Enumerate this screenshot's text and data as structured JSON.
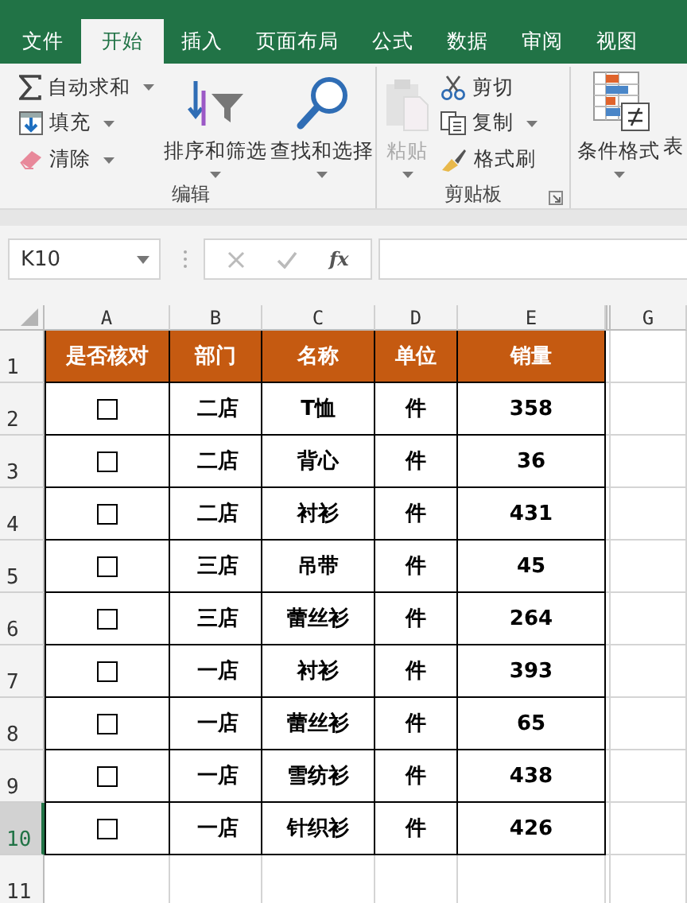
{
  "tabs": [
    {
      "label": "文件",
      "selected": false
    },
    {
      "label": "开始",
      "selected": true
    },
    {
      "label": "插入",
      "selected": false
    },
    {
      "label": "页面布局",
      "selected": false
    },
    {
      "label": "公式",
      "selected": false
    },
    {
      "label": "数据",
      "selected": false
    },
    {
      "label": "审阅",
      "selected": false
    },
    {
      "label": "视图",
      "selected": false
    }
  ],
  "ribbon": {
    "groups": [
      {
        "label": "编辑",
        "items": [
          {
            "kind": "small",
            "label": "自动求和",
            "dropdown": true
          },
          {
            "kind": "small",
            "label": "填充",
            "dropdown": true
          },
          {
            "kind": "small",
            "label": "清除",
            "dropdown": true
          },
          {
            "kind": "large",
            "label": "排序和筛选",
            "dropdown": true
          },
          {
            "kind": "large",
            "label": "查找和选择",
            "dropdown": true
          }
        ]
      },
      {
        "label": "剪贴板",
        "launcher": true,
        "items": [
          {
            "kind": "large",
            "label": "粘贴",
            "dropdown": true,
            "disabled": true
          },
          {
            "kind": "small",
            "label": "剪切"
          },
          {
            "kind": "small",
            "label": "复制",
            "dropdown": true
          },
          {
            "kind": "small",
            "label": "格式刷"
          }
        ]
      },
      {
        "items": [
          {
            "kind": "large",
            "label": "条件格式",
            "dropdown": true
          },
          {
            "kind": "partial",
            "label": "表"
          }
        ]
      }
    ]
  },
  "formula_bar": {
    "name_box": "K10",
    "function_button": "fx"
  },
  "sheet": {
    "columns": [
      {
        "label": "A"
      },
      {
        "label": "B"
      },
      {
        "label": "C"
      },
      {
        "label": "D"
      },
      {
        "label": "E"
      },
      {
        "label": "G"
      }
    ],
    "header_row": {
      "number": "1",
      "selected": false,
      "cells": [
        "是否核对",
        "部门",
        "名称",
        "单位",
        "销量"
      ]
    },
    "rows": [
      {
        "number": "2",
        "selected": false,
        "checked": false,
        "department": "二店",
        "name": "T恤",
        "unit": "件",
        "sales": "358"
      },
      {
        "number": "3",
        "selected": false,
        "checked": false,
        "department": "二店",
        "name": "背心",
        "unit": "件",
        "sales": "36"
      },
      {
        "number": "4",
        "selected": false,
        "checked": false,
        "department": "二店",
        "name": "衬衫",
        "unit": "件",
        "sales": "431"
      },
      {
        "number": "5",
        "selected": false,
        "checked": false,
        "department": "三店",
        "name": "吊带",
        "unit": "件",
        "sales": "45"
      },
      {
        "number": "6",
        "selected": false,
        "checked": false,
        "department": "三店",
        "name": "蕾丝衫",
        "unit": "件",
        "sales": "264"
      },
      {
        "number": "7",
        "selected": false,
        "checked": false,
        "department": "一店",
        "name": "衬衫",
        "unit": "件",
        "sales": "393"
      },
      {
        "number": "8",
        "selected": false,
        "checked": false,
        "department": "一店",
        "name": "蕾丝衫",
        "unit": "件",
        "sales": "65"
      },
      {
        "number": "9",
        "selected": false,
        "checked": false,
        "department": "一店",
        "name": "雪纺衫",
        "unit": "件",
        "sales": "438"
      },
      {
        "number": "10",
        "selected": true,
        "checked": false,
        "department": "一店",
        "name": "针织衫",
        "unit": "件",
        "sales": "426"
      }
    ],
    "empty_rows": [
      {
        "number": "11",
        "selected": false
      }
    ]
  }
}
